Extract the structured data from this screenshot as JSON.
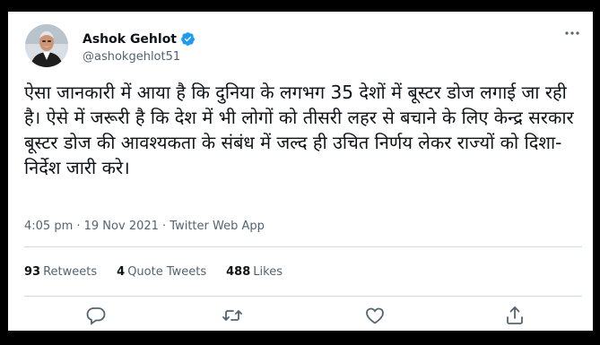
{
  "author": {
    "name": "Ashok Gehlot",
    "handle": "@ashokgehlot51",
    "verified": true
  },
  "tweet": {
    "text": "ऐसा जानकारी में आया है कि दुनिया के लगभग 35 देशों में बूस्टर डोज लगाई जा रही है। ऐसे में जरूरी है कि देश में भी लोगों को तीसरी लहर से बचाने के लिए केन्द्र सरकार बूस्टर डोज की आवश्यकता के संबंध में जल्द ही उचित निर्णय लेकर राज्यों को दिशा-निर्देश जारी करे।",
    "meta": "4:05 pm · 19 Nov 2021 · Twitter Web App"
  },
  "stats": {
    "retweets_count": "93",
    "retweets_label": "Retweets",
    "quotes_count": "4",
    "quotes_label": "Quote Tweets",
    "likes_count": "488",
    "likes_label": "Likes"
  },
  "actions": [
    "reply-icon",
    "retweet-icon",
    "like-icon",
    "share-icon"
  ],
  "colors": {
    "text": "#0f1419",
    "secondary": "#536471",
    "divider": "#cfd9de",
    "verified": "#1d9bf0"
  }
}
